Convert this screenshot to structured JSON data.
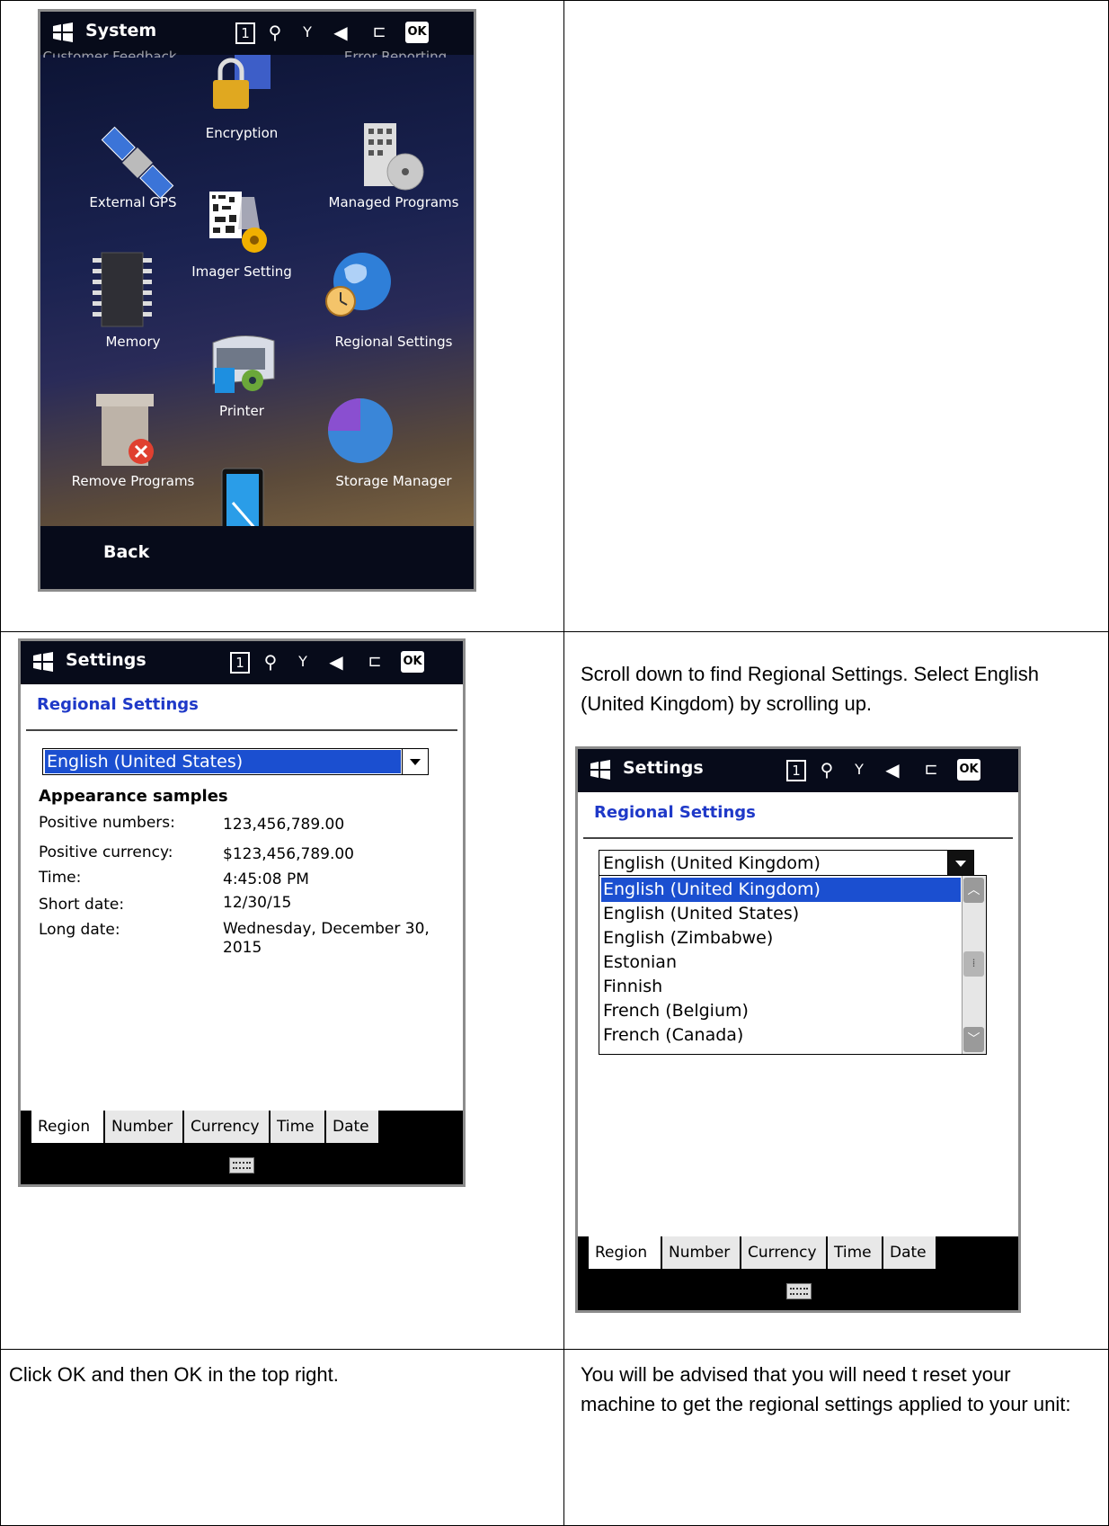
{
  "panel_system": {
    "title": "System",
    "status": {
      "box": "1",
      "ok": "OK"
    },
    "top_labels": [
      "Customer Feedback",
      "Error Reporting"
    ],
    "icons": [
      {
        "label": "Encryption",
        "icon": "lock-icon"
      },
      {
        "label": "External GPS",
        "icon": "satellite-icon"
      },
      {
        "label": "Managed Programs",
        "icon": "building-cd-icon"
      },
      {
        "label": "Imager Setting",
        "icon": "barcode-gear-icon"
      },
      {
        "label": "Memory",
        "icon": "chip-icon"
      },
      {
        "label": "Regional Settings",
        "icon": "globe-clock-icon"
      },
      {
        "label": "Printer",
        "icon": "printer-icon"
      },
      {
        "label": "Remove Programs",
        "icon": "box-remove-icon"
      },
      {
        "label": "Storage Manager",
        "icon": "pie-icon"
      }
    ],
    "softkey": "Back"
  },
  "panel_settings": {
    "title": "Settings",
    "status": {
      "box": "1",
      "ok": "OK"
    },
    "heading": "Regional Settings",
    "selected": "English (United States)",
    "samples_title": "Appearance samples",
    "samples": [
      {
        "label": "Positive numbers:",
        "value": "123,456,789.00"
      },
      {
        "label": "Positive currency:",
        "value": "$123,456,789.00"
      },
      {
        "label": "Time:",
        "value": "4:45:08 PM"
      },
      {
        "label": "Short date:",
        "value": "12/30/15"
      },
      {
        "label": "Long date:",
        "value": "Wednesday, December 30, 2015"
      }
    ],
    "tabs": [
      "Region",
      "Number",
      "Currency",
      "Time",
      "Date"
    ]
  },
  "instruction_1": "Scroll down to find Regional Settings.  Select English (United Kingdom) by scrolling up.",
  "panel_dropdown": {
    "title": "Settings",
    "status": {
      "box": "1",
      "ok": "OK"
    },
    "heading": "Regional Settings",
    "selected": "English (United Kingdom)",
    "options": [
      "English (United Kingdom)",
      "English (United States)",
      "English (Zimbabwe)",
      "Estonian",
      "Finnish",
      "French (Belgium)",
      "French (Canada)"
    ],
    "tabs": [
      "Region",
      "Number",
      "Currency",
      "Time",
      "Date"
    ]
  },
  "instruction_2": "Click OK and then OK in the top right.",
  "instruction_3": "You will be advised that you will need t reset your machine to get the regional settings applied to your unit:"
}
